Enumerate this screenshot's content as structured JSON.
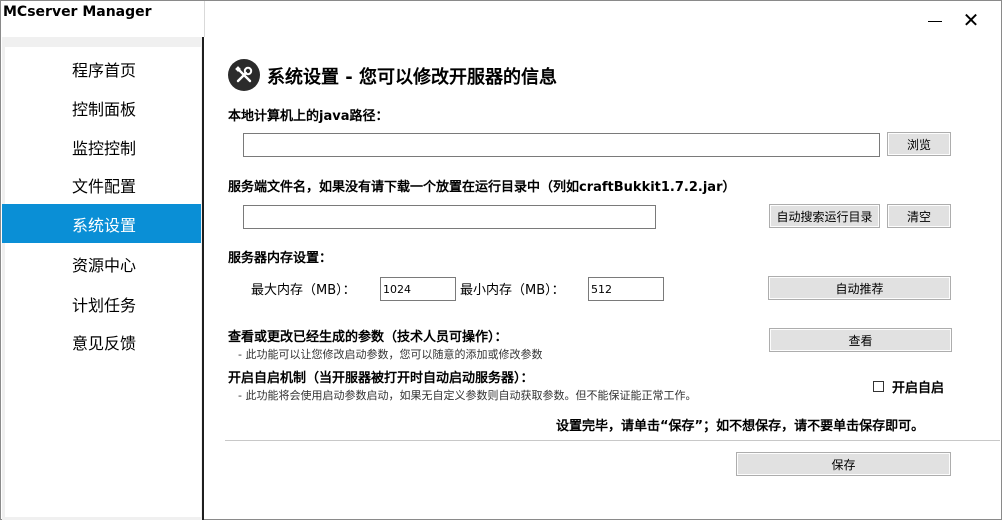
{
  "window": {
    "title": "MCserver Manager",
    "minimize_icon": "minimize-icon",
    "close_icon": "close-icon",
    "close_glyph": "✕"
  },
  "sidebar": {
    "items": [
      {
        "label": "程序首页",
        "selected": false
      },
      {
        "label": "控制面板",
        "selected": false
      },
      {
        "label": "监控控制",
        "selected": false
      },
      {
        "label": "文件配置",
        "selected": false
      },
      {
        "label": "系统设置",
        "selected": true
      },
      {
        "label": "资源中心",
        "selected": false
      },
      {
        "label": "计划任务",
        "selected": false
      },
      {
        "label": "意见反馈",
        "selected": false
      }
    ],
    "selected_color": "#0a8fd6"
  },
  "main": {
    "header_icon": "tools-icon",
    "title": "系统设置 - 您可以修改开服器的信息",
    "java": {
      "label": "本地计算机上的java路径：",
      "value": "",
      "browse_label": "浏览"
    },
    "server_file": {
      "label": "服务端文件名，如果没有请下载一个放置在运行目录中（列如craftBukkit1.7.2.jar）",
      "value": "",
      "auto_search_label": "自动搜索运行目录",
      "clear_label": "清空"
    },
    "memory": {
      "label": "服务器内存设置：",
      "max_label": "最大内存（MB）：",
      "max_value": "1024",
      "min_label": "最小内存（MB）：",
      "min_value": "512",
      "recommend_label": "自动推荐"
    },
    "params": {
      "label": "查看或更改已经生成的参数（技术人员可操作）：",
      "note": "- 此功能可以让您修改启动参数，您可以随意的添加或修改参数",
      "view_label": "查看"
    },
    "autostart": {
      "label": "开启自启机制（当开服器被打开时自动启动服务器）：",
      "note": "- 此功能将会使用启动参数启动，如果无自定义参数则自动获取参数。但不能保证能正常工作。",
      "checkbox_label": "开启自启",
      "checked": false
    },
    "save_note": "设置完毕，请单击“保存”；如不想保存，请不要单击保存即可。",
    "save_label": "保存"
  }
}
